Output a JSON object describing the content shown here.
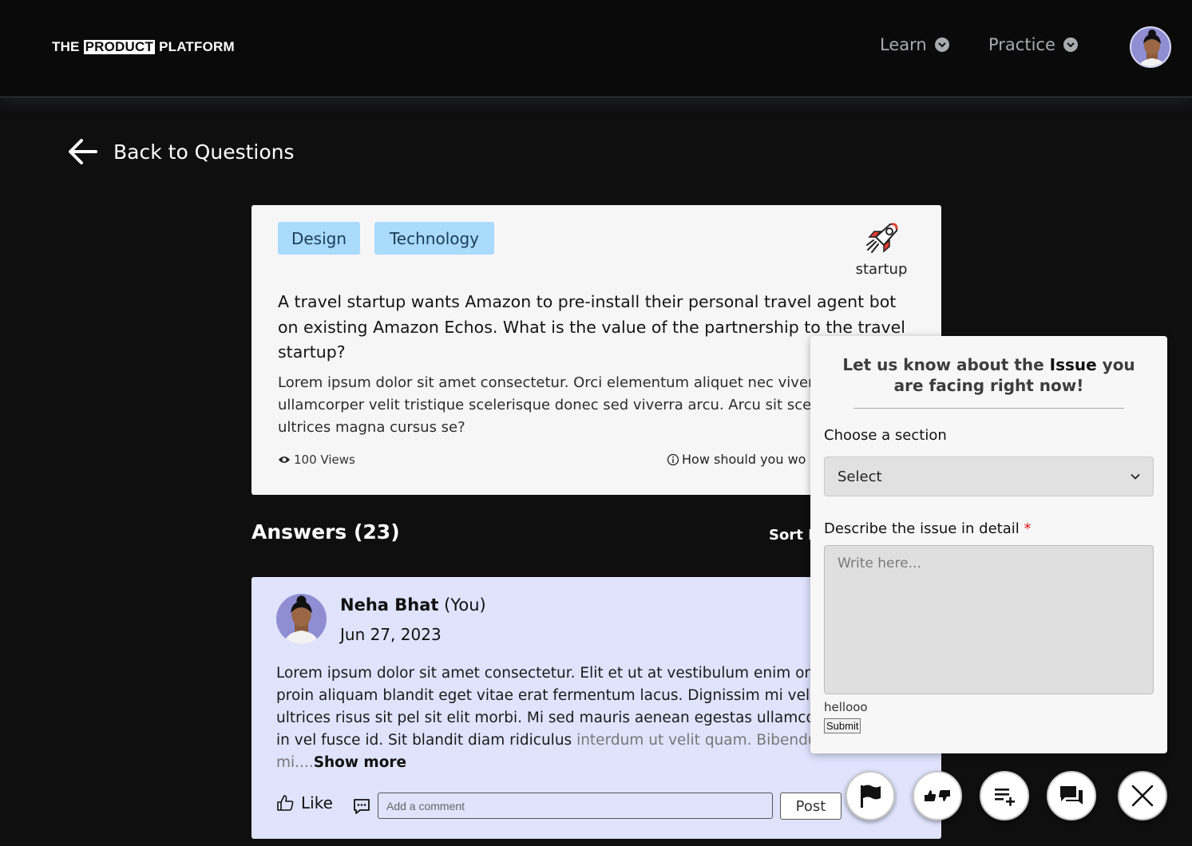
{
  "header": {
    "logo_prefix": "THE",
    "logo_boxed": "PRODUCT",
    "logo_suffix": "PLATFORM",
    "nav": [
      {
        "label": "Learn"
      },
      {
        "label": "Practice"
      }
    ]
  },
  "back_link": {
    "label": "Back to Questions"
  },
  "question": {
    "tags": [
      "Design",
      "Technology"
    ],
    "category": "startup",
    "title": "A travel startup wants Amazon to pre-install their personal travel agent bot on existing Amazon Echos. What is the value of the partnership to the travel startup?",
    "body": "Lorem ipsum dolor sit amet consectetur. Orci elementum aliquet nec viverra ? Amet ullamcorper velit tristique scelerisque donec sed viverra arcu. Arcu sit scelerisque ultrices magna cursus se?",
    "views": "100 Views",
    "hint": "How should you wo"
  },
  "answers": {
    "title": "Answers (23)",
    "sort_label": "Sort B"
  },
  "answer": {
    "author": "Neha Bhat",
    "author_suffix": "(You)",
    "date": "Jun 27, 2023",
    "body_main": "Lorem ipsum dolor sit amet consectetur. Elit et ut at vestibulum enim ornare vitae. Eget proin aliquam blandit eget vitae erat fermentum lacus. Dignissim mi vel fermentum. Id ultrices risus sit pel sit elit morbi. Mi sed mauris aenean egestas ullamcorper. Dignissim in vel fusce id. Sit blandit diam ridiculus ",
    "body_fade": "interdum ut velit quam. Bibendum amet mi....",
    "show_more": "Show more",
    "like_label": "Like",
    "comment_placeholder": "Add a comment",
    "post_label": "Post"
  },
  "issue_panel": {
    "title_prefix": "Let us know about the ",
    "title_bold": "Issue",
    "title_suffix": " you are facing right now!",
    "section_label": "Choose a section",
    "select_value": "Select",
    "detail_label": "Describe the issue in detail",
    "required_mark": "*",
    "textarea_placeholder": "Write here...",
    "echo_text": "hellooo",
    "submit_label": "Submit"
  },
  "fabs": [
    {
      "icon": "flag-icon"
    },
    {
      "icon": "thumbs-up-down-icon"
    },
    {
      "icon": "playlist-add-icon"
    },
    {
      "icon": "chat-icon"
    },
    {
      "icon": "close-icon"
    }
  ],
  "colors": {
    "background": "#0f0f0f",
    "tag": "#aadafc",
    "answer_card": "#dfe3fc",
    "avatar": "#8f8ed3",
    "required": "#e01515"
  }
}
